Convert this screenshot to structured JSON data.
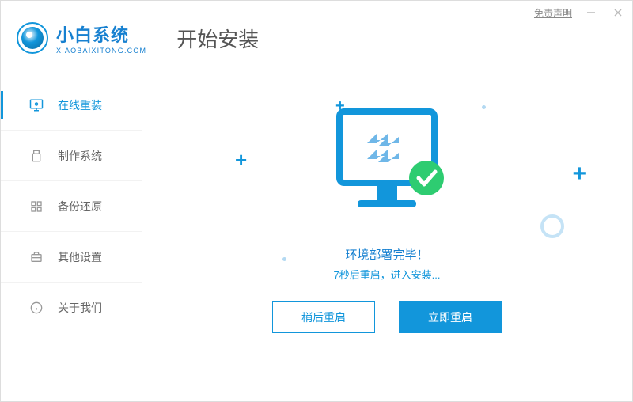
{
  "titlebar": {
    "disclaimer": "免责声明"
  },
  "brand": {
    "name": "小白系统",
    "sub": "XIAOBAIXITONG.COM"
  },
  "page_title": "开始安装",
  "sidebar": {
    "items": [
      {
        "label": "在线重装"
      },
      {
        "label": "制作系统"
      },
      {
        "label": "备份还原"
      },
      {
        "label": "其他设置"
      },
      {
        "label": "关于我们"
      }
    ]
  },
  "main": {
    "status": "环境部署完毕！",
    "countdown": "7秒后重启，进入安装...",
    "btn_later": "稍后重启",
    "btn_now": "立即重启"
  }
}
